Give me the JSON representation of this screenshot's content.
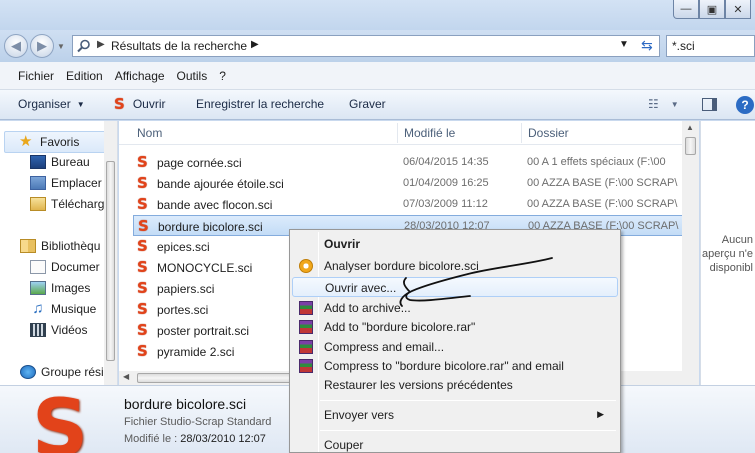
{
  "address": {
    "path_label": "Résultats de la recherche",
    "search_value": "*.sci"
  },
  "menu": [
    "Fichier",
    "Edition",
    "Affichage",
    "Outils",
    "?"
  ],
  "toolbar": {
    "organize": "Organiser",
    "open": "Ouvrir",
    "save_search": "Enregistrer la recherche",
    "burn": "Graver"
  },
  "nav": {
    "favorites": "Favoris",
    "desktop": "Bureau",
    "places": "Emplacer",
    "downloads": "Télécharg",
    "libraries": "Bibliothèqu",
    "documents": "Documer",
    "images": "Images",
    "music": "Musique",
    "videos": "Vidéos",
    "homegroup": "Groupe rési"
  },
  "columns": {
    "name": "Nom",
    "modified": "Modifié le",
    "folder": "Dossier"
  },
  "files": [
    {
      "name": "page cornée.sci",
      "date": "06/04/2015 14:35",
      "folder": "00 A 1 effets spéciaux (F:\\00"
    },
    {
      "name": "bande ajourée étoile.sci",
      "date": "01/04/2009 16:25",
      "folder": "00 AZZA BASE (F:\\00  SCRAP\\"
    },
    {
      "name": "bande avec flocon.sci",
      "date": "07/03/2009 11:12",
      "folder": "00 AZZA BASE (F:\\00  SCRAP\\"
    },
    {
      "name": "bordure bicolore.sci",
      "date": "28/03/2010 12:07",
      "folder": "00 AZZA BASE (F:\\00  SCRAP\\"
    },
    {
      "name": "epices.sci",
      "date": "",
      "folder": ""
    },
    {
      "name": "MONOCYCLE.sci",
      "date": "",
      "folder": ""
    },
    {
      "name": "papiers.sci",
      "date": "",
      "folder": ""
    },
    {
      "name": "portes.sci",
      "date": "",
      "folder": ""
    },
    {
      "name": "poster portrait.sci",
      "date": "",
      "folder": ""
    },
    {
      "name": "pyramide 2.sci",
      "date": "",
      "folder": ""
    }
  ],
  "preview": {
    "line1": "Aucun",
    "line2": "aperçu n'e",
    "line3": "disponibl"
  },
  "details": {
    "name": "bordure bicolore.sci",
    "type": "Fichier Studio-Scrap Standard",
    "modified_label": "Modifié le :",
    "modified_value": "28/03/2010 12:07"
  },
  "context_menu": {
    "open": "Ouvrir",
    "analyze": "Analyser bordure bicolore.sci",
    "open_with": "Ouvrir avec...",
    "add_archive": "Add to archive...",
    "add_rar": "Add to \"bordure bicolore.rar\"",
    "compress_email": "Compress and email...",
    "compress_rar_email": "Compress to \"bordure bicolore.rar\" and email",
    "restore": "Restaurer les versions précédentes",
    "send_to": "Envoyer vers",
    "cut": "Couper"
  },
  "colors": {
    "accent": "#2c6cc4",
    "studio_scrap": "#e2431a",
    "selection": "#c3dcf6"
  }
}
